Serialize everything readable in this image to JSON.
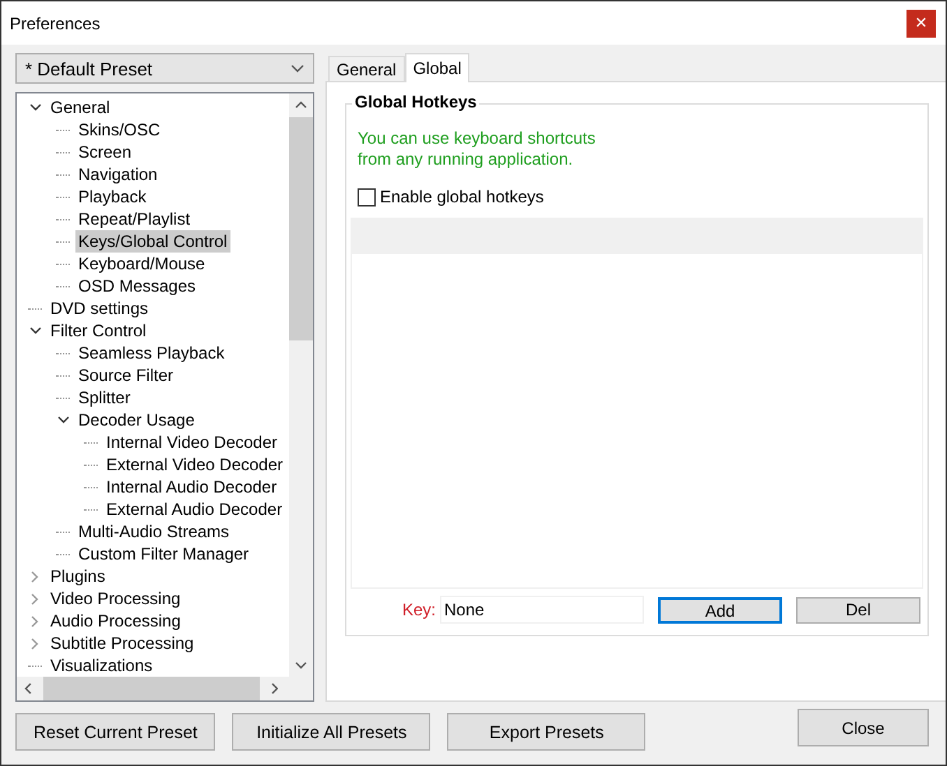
{
  "window": {
    "title": "Preferences",
    "close": "✕"
  },
  "preset": {
    "value": "* Default Preset"
  },
  "tree": [
    {
      "label": "General",
      "expanded": true,
      "selected": false,
      "children": [
        {
          "label": "Skins/OSC",
          "selected": false
        },
        {
          "label": "Screen",
          "selected": false
        },
        {
          "label": "Navigation",
          "selected": false
        },
        {
          "label": "Playback",
          "selected": false
        },
        {
          "label": "Repeat/Playlist",
          "selected": false
        },
        {
          "label": "Keys/Global Control",
          "selected": true
        },
        {
          "label": "Keyboard/Mouse",
          "selected": false
        },
        {
          "label": "OSD Messages",
          "selected": false
        }
      ]
    },
    {
      "label": "DVD settings",
      "selected": false
    },
    {
      "label": "Filter Control",
      "expanded": true,
      "selected": false,
      "children": [
        {
          "label": "Seamless Playback",
          "selected": false
        },
        {
          "label": "Source Filter",
          "selected": false
        },
        {
          "label": "Splitter",
          "selected": false
        },
        {
          "label": "Decoder Usage",
          "expanded": true,
          "selected": false,
          "children": [
            {
              "label": "Internal Video Decoder",
              "selected": false
            },
            {
              "label": "External Video Decoder",
              "selected": false
            },
            {
              "label": "Internal Audio Decoder",
              "selected": false
            },
            {
              "label": "External Audio Decoder",
              "selected": false
            }
          ]
        },
        {
          "label": "Multi-Audio Streams",
          "selected": false
        },
        {
          "label": "Custom Filter Manager",
          "selected": false
        }
      ]
    },
    {
      "label": "Plugins",
      "expanded": false,
      "selected": false
    },
    {
      "label": "Video Processing",
      "expanded": false,
      "selected": false
    },
    {
      "label": "Audio Processing",
      "expanded": false,
      "selected": false
    },
    {
      "label": "Subtitle Processing",
      "expanded": false,
      "selected": false
    },
    {
      "label": "Visualizations",
      "selected": false
    }
  ],
  "tabs": [
    {
      "label": "General",
      "selected": false
    },
    {
      "label": "Global",
      "selected": true
    }
  ],
  "group": {
    "title": "Global Hotkeys",
    "note_lines": [
      "You can use keyboard shortcuts",
      "from any running application."
    ],
    "enable": {
      "label": "Enable global hotkeys",
      "checked": false
    },
    "key_label": "Key:",
    "key_value": "None",
    "buttons": [
      {
        "label": "Add",
        "focused": true
      },
      {
        "label": "Del",
        "focused": false
      }
    ]
  },
  "footer_buttons": [
    "Reset Current Preset",
    "Initialize All Presets",
    "Export Presets"
  ],
  "close_button": "Close"
}
